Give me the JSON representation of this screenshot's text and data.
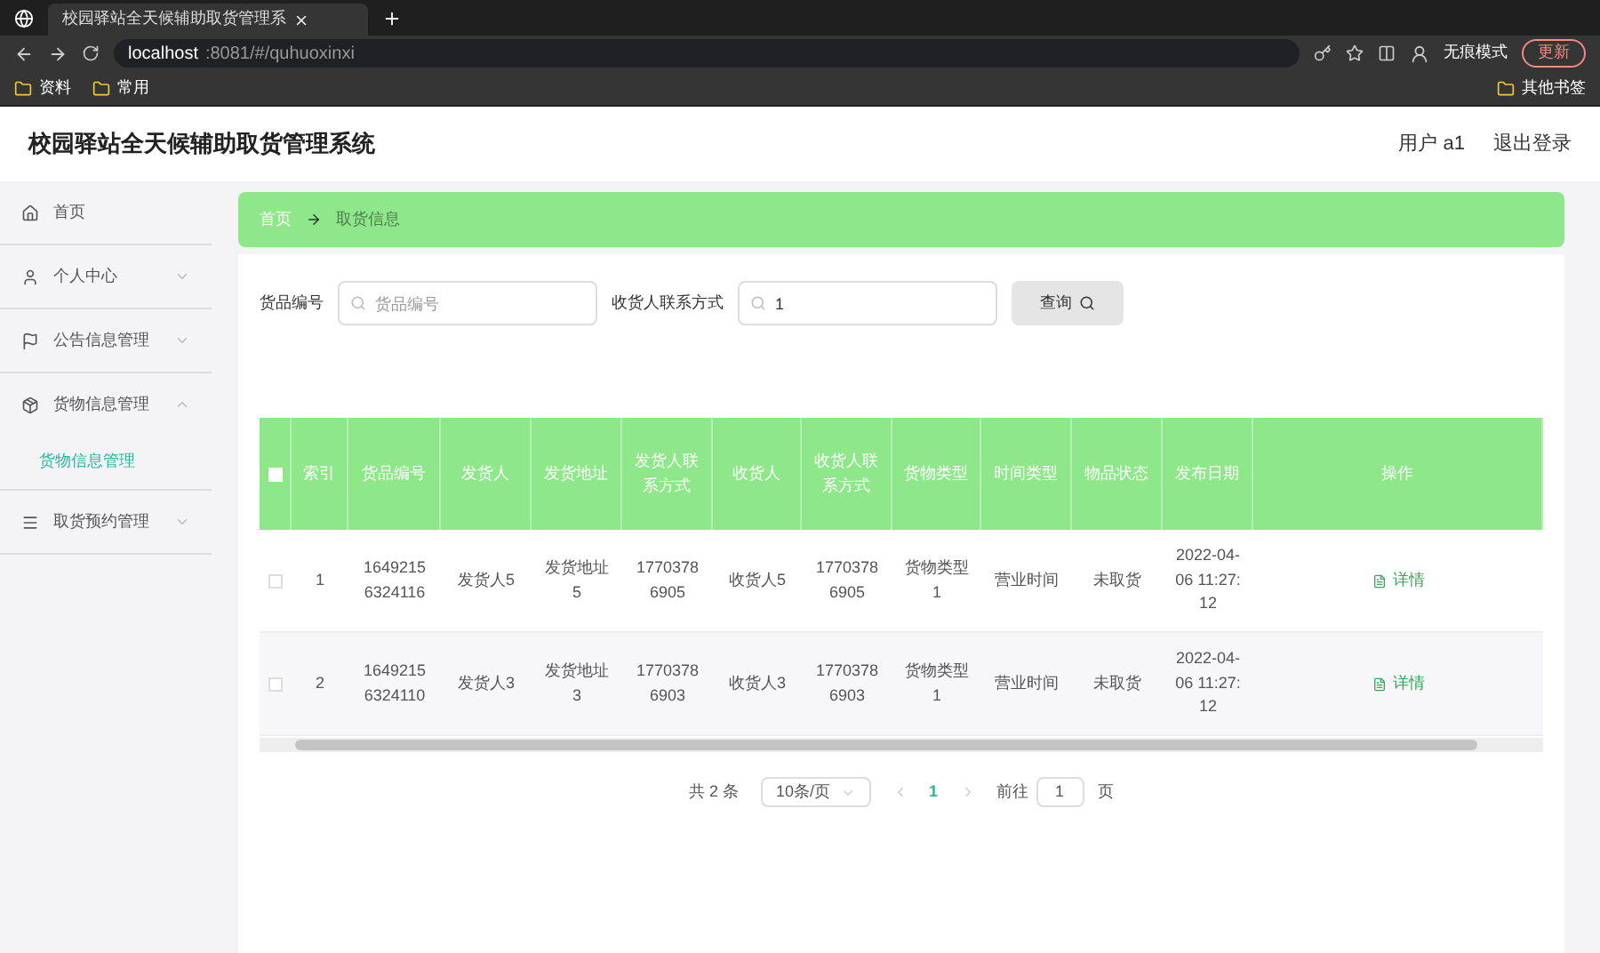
{
  "browser": {
    "tab_title": "校园驿站全天候辅助取货管理系",
    "url_host": "localhost",
    "url_path": ":8081/#/quhuoxinxi",
    "profile": "无痕模式",
    "update": "更新",
    "bookmarks": [
      "资料",
      "常用"
    ],
    "other_bookmarks": "其他书签"
  },
  "header": {
    "title": "校园驿站全天候辅助取货管理系统",
    "user": "用户 a1",
    "logout": "退出登录"
  },
  "sidebar": {
    "items": [
      {
        "label": "首页"
      },
      {
        "label": "个人中心",
        "expanded": false
      },
      {
        "label": "公告信息管理",
        "expanded": false
      },
      {
        "label": "货物信息管理",
        "expanded": true,
        "children": [
          {
            "label": "货物信息管理",
            "selected": true
          }
        ]
      },
      {
        "label": "取货预约管理",
        "expanded": false
      }
    ]
  },
  "breadcrumb": [
    "首页",
    "取货信息"
  ],
  "search": {
    "fields": [
      {
        "label": "货品编号",
        "placeholder": "货品编号"
      },
      {
        "label": "收货人联系方式",
        "value": "1"
      }
    ],
    "button": "查询"
  },
  "table": {
    "all_checked": false,
    "columns": [
      "索引",
      "货品编号",
      "发货人",
      "发货地址",
      "发货人联系方式",
      "收货人",
      "收货人联系方式",
      "货物类型",
      "时间类型",
      "物品状态",
      "发布日期",
      "操作"
    ],
    "rows": [
      {
        "checked": false,
        "cells": [
          "1",
          "16492156324116",
          "发货人5",
          "发货地址5",
          "17703786905",
          "收货人5",
          "17703786905",
          "货物类型1",
          "营业时间",
          "未取货",
          "2022-04-06 11:27:12"
        ],
        "action": "详情"
      },
      {
        "checked": false,
        "cells": [
          "2",
          "16492156324110",
          "发货人3",
          "发货地址3",
          "17703786903",
          "收货人3",
          "17703786903",
          "货物类型1",
          "营业时间",
          "未取货",
          "2022-04-06 11:27:12"
        ],
        "action": "详情"
      }
    ]
  },
  "pagination": {
    "total": "共 2 条",
    "page_size": "10条/页",
    "pages": [
      {
        "label": "1",
        "selected": true
      }
    ],
    "goto_label": "前往",
    "goto_value": "1",
    "goto_suffix": "页"
  }
}
